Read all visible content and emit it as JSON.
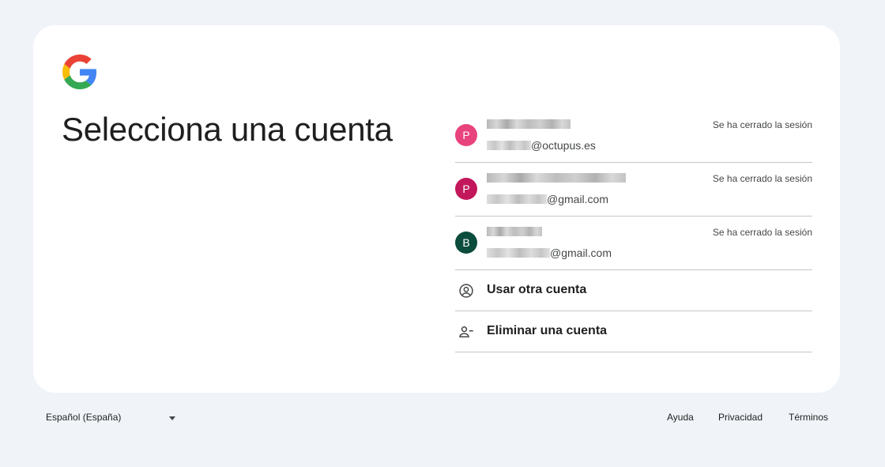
{
  "page": {
    "title": "Selecciona una cuenta"
  },
  "accounts": [
    {
      "initial": "P",
      "avatar_color": "#e8437c",
      "email_suffix": "@octupus.es",
      "status": "Se ha cerrado la sesión"
    },
    {
      "initial": "P",
      "avatar_color": "#c2185b",
      "email_suffix": "@gmail.com",
      "status": "Se ha cerrado la sesión"
    },
    {
      "initial": "B",
      "avatar_color": "#0b4c3c",
      "email_suffix": "@gmail.com",
      "status": "Se ha cerrado la sesión"
    }
  ],
  "actions": {
    "use_other": {
      "label": "Usar otra cuenta",
      "icon": "account-circle-icon"
    },
    "remove": {
      "label": "Eliminar una cuenta",
      "icon": "person-remove-icon"
    }
  },
  "footer": {
    "language": "Español (España)",
    "help": "Ayuda",
    "privacy": "Privacidad",
    "terms": "Términos"
  },
  "colors": {
    "background": "#f0f4f9",
    "card": "#ffffff",
    "divider": "#c4c7c5",
    "text": "#1f1f1f"
  }
}
